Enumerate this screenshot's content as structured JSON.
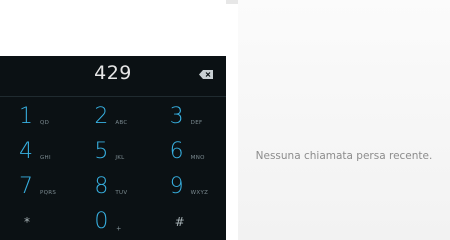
{
  "dialer": {
    "digits": "429",
    "keys": [
      [
        {
          "num": "1",
          "letters": "QD"
        },
        {
          "num": "2",
          "letters": "ABC"
        },
        {
          "num": "3",
          "letters": "DEF"
        }
      ],
      [
        {
          "num": "4",
          "letters": "GHI"
        },
        {
          "num": "5",
          "letters": "JKL"
        },
        {
          "num": "6",
          "letters": "MNO"
        }
      ],
      [
        {
          "num": "7",
          "letters": "PQRS"
        },
        {
          "num": "8",
          "letters": "TUV"
        },
        {
          "num": "9",
          "letters": "WXYZ"
        }
      ],
      [
        {
          "sym": "*"
        },
        {
          "num": "0",
          "letters": "+"
        },
        {
          "sym": "#"
        }
      ]
    ]
  },
  "call_log": {
    "empty_message": "Nessuna chiamata persa recente."
  },
  "colors": {
    "dialpad_bg": "#0b1114",
    "accent": "#37b0e1"
  },
  "icons": {
    "backspace": "backspace-icon"
  }
}
